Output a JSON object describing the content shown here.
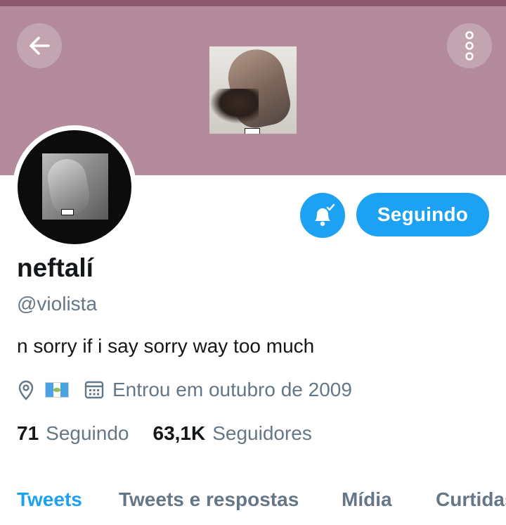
{
  "header": {
    "back_icon": "arrow-left-icon",
    "more_icon": "more-vertical-icon"
  },
  "actions": {
    "bell_icon": "bell-check-icon",
    "follow_label": "Seguindo"
  },
  "profile": {
    "name": "neftalí",
    "handle": "@violista",
    "bio": "n sorry if i say sorry way too much",
    "location_icon": "location-pin-icon",
    "location_flag": "guatemala-flag-icon",
    "joined_icon": "calendar-icon",
    "joined": "Entrou em outubro de 2009"
  },
  "stats": {
    "following_count": "71",
    "following_label": "Seguindo",
    "followers_count": "63,1K",
    "followers_label": "Seguidores"
  },
  "tabs": [
    {
      "label": "Tweets",
      "active": true
    },
    {
      "label": "Tweets e respostas",
      "active": false
    },
    {
      "label": "Mídia",
      "active": false
    },
    {
      "label": "Curtidas",
      "active": false
    }
  ],
  "colors": {
    "accent": "#1da1f2",
    "banner": "#b38b9c",
    "text_primary": "#14171a",
    "text_secondary": "#657786"
  }
}
